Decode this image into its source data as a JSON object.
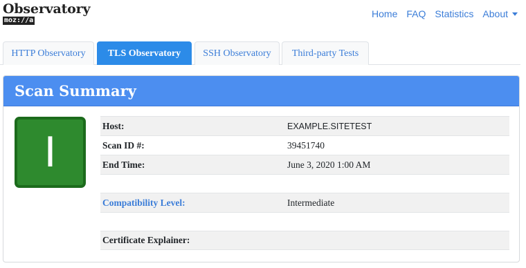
{
  "header": {
    "logo_title": "Observatory",
    "logo_subtitle": "moz://a",
    "nav": [
      "Home",
      "FAQ",
      "Statistics",
      "About"
    ]
  },
  "tabs": [
    {
      "label": "HTTP Observatory",
      "active": false
    },
    {
      "label": "TLS Observatory",
      "active": true
    },
    {
      "label": "SSH Observatory",
      "active": false
    },
    {
      "label": "Third-party Tests",
      "active": false
    }
  ],
  "card": {
    "title": "Scan Summary",
    "grade": "I",
    "grade_color": "#2e8a2e",
    "rows": [
      {
        "label": "Host:",
        "value": "EXAMPLE.SITETEST"
      },
      {
        "label": "Scan ID #:",
        "value": "39451740"
      },
      {
        "label": "End Time:",
        "value": "June 3, 2020 1:00 AM"
      },
      {
        "label": "",
        "value": ""
      },
      {
        "label": "Compatibility Level:",
        "value": "Intermediate"
      },
      {
        "label": "",
        "value": ""
      },
      {
        "label": "Certificate Explainer:",
        "value": ""
      }
    ]
  },
  "colors": {
    "accent": "#3b7dd8",
    "active_tab": "#2c8be8",
    "card_header": "#4c8ef0",
    "grade_border": "#1c6b1c"
  }
}
